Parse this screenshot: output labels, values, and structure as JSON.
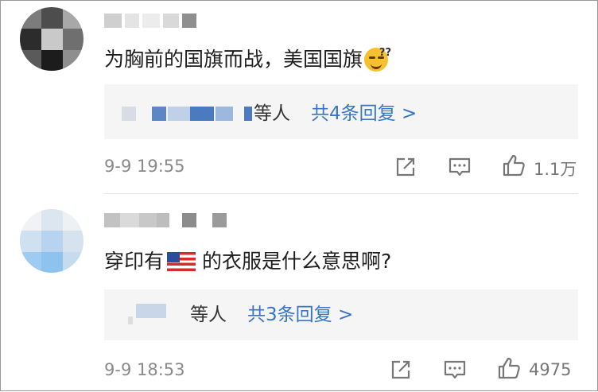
{
  "comments": [
    {
      "text": "为胸前的国旗而战，美国国旗",
      "emoji_icon": "thinking-grin-emoji",
      "replies": {
        "others_label": "等人",
        "total_label": "共4条回复 >"
      },
      "time": "9-9 19:55",
      "likes": "1.1万"
    },
    {
      "text_before_flag": "穿印有",
      "flag_icon": "us-flag-emoji",
      "text_after_flag": "的衣服是什么意思啊?",
      "replies": {
        "others_label": "等人",
        "total_label": "共3条回复 >"
      },
      "time": "9-9 18:53",
      "likes": "4975"
    }
  ],
  "icons": {
    "share": "share-icon",
    "comment": "comment-icon",
    "like": "thumbs-up-icon"
  },
  "colors": {
    "link_blue": "#3a74c3",
    "meta_gray": "#8a8a8a",
    "reply_bg": "#f5f5f5"
  }
}
